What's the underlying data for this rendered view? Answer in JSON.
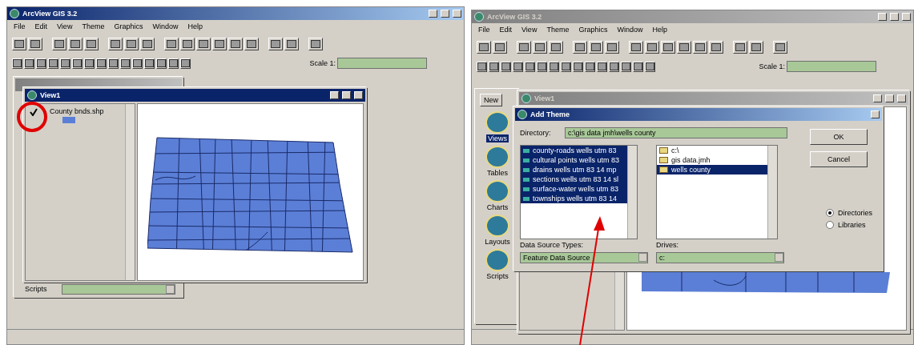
{
  "left_screen": {
    "app_title": "ArcView GIS 3.2",
    "menus": [
      "File",
      "Edit",
      "View",
      "Theme",
      "Graphics",
      "Window",
      "Help"
    ],
    "scale_label": "Scale 1:",
    "project_label": "Scripts",
    "view_window": {
      "title": "View1",
      "themes": [
        {
          "name": "County bnds.shp",
          "visible": true
        }
      ]
    }
  },
  "right_screen": {
    "app_title": "ArcView GIS 3.2",
    "menus": [
      "File",
      "Edit",
      "View",
      "Theme",
      "Graphics",
      "Window",
      "Help"
    ],
    "scale_label": "Scale 1:",
    "project_window": {
      "button": "New",
      "items": [
        {
          "label": "Views",
          "selected": true
        },
        {
          "label": "Tables",
          "selected": false
        },
        {
          "label": "Charts",
          "selected": false
        },
        {
          "label": "Layouts",
          "selected": false
        },
        {
          "label": "Scripts",
          "selected": false
        }
      ]
    },
    "view_window": {
      "title": "View1"
    },
    "add_theme": {
      "title": "Add Theme",
      "directory_label": "Directory:",
      "directory": "c:\\gis data jmh\\wells county",
      "files": [
        {
          "name": "county-roads wells utm 83",
          "selected": true
        },
        {
          "name": "cultural points wells utm 83",
          "selected": true
        },
        {
          "name": "drains wells utm 83 14 mp",
          "selected": true
        },
        {
          "name": "sections wells utm 83 14 sl",
          "selected": true
        },
        {
          "name": "surface-water wells utm 83",
          "selected": true
        },
        {
          "name": "townships wells utm 83 14",
          "selected": true
        }
      ],
      "folders": [
        {
          "name": "c:\\",
          "selected": false
        },
        {
          "name": "gis data.jmh",
          "selected": false
        },
        {
          "name": "wells county",
          "selected": true
        }
      ],
      "buttons": [
        "OK",
        "Cancel"
      ],
      "radios": [
        {
          "label": "Directories",
          "selected": true
        },
        {
          "label": "Libraries",
          "selected": false
        }
      ],
      "source_types_label": "Data Source Types:",
      "source_type": "Feature Data Source",
      "drives_label": "Drives:",
      "drive": "c:"
    }
  }
}
